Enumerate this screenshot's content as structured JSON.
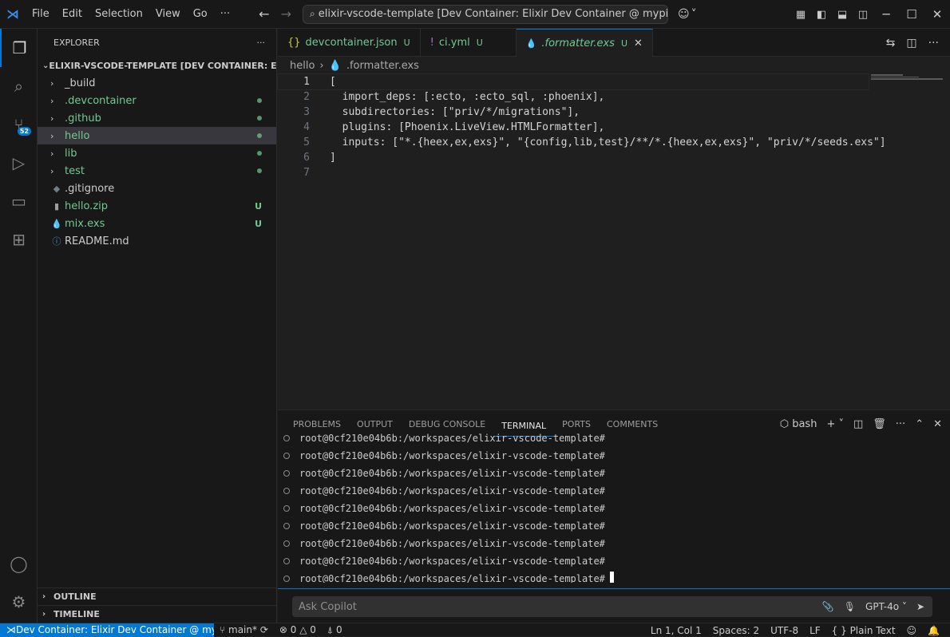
{
  "titlebar": {
    "menu": [
      "File",
      "Edit",
      "Selection",
      "View",
      "Go",
      "···"
    ],
    "nav_back": "←",
    "nav_forward": "→",
    "command_center": "elixir-vscode-template [Dev Container: Elixir Dev Container @ mypi4.local]",
    "copilot_chevron": "˅"
  },
  "activity": {
    "scm_badge": "52"
  },
  "sidebar": {
    "title": "EXPLORER",
    "more": "···",
    "root": "ELIXIR-VSCODE-TEMPLATE [DEV CONTAINER: ELIXI...",
    "items": [
      {
        "label": "_build",
        "type": "folder"
      },
      {
        "label": ".devcontainer",
        "type": "folder"
      },
      {
        "label": ".github",
        "type": "folder"
      },
      {
        "label": "hello",
        "type": "folder"
      },
      {
        "label": "lib",
        "type": "folder"
      },
      {
        "label": "test",
        "type": "folder"
      },
      {
        "label": ".gitignore",
        "type": "file"
      },
      {
        "label": "hello.zip",
        "type": "file",
        "status": "U"
      },
      {
        "label": "mix.exs",
        "type": "file",
        "status": "U"
      },
      {
        "label": "README.md",
        "type": "file"
      }
    ],
    "outline": "OUTLINE",
    "timeline": "TIMELINE"
  },
  "tabs": [
    {
      "label": "devcontainer.json",
      "status": "U",
      "icon": "{}"
    },
    {
      "label": "ci.yml",
      "status": "U",
      "icon": "!"
    },
    {
      "label": ".formatter.exs",
      "status": "U",
      "icon": "💧"
    }
  ],
  "breadcrumb": {
    "folder": "hello",
    "file": ".formatter.exs"
  },
  "editor": {
    "lines": [
      "[",
      "  import_deps: [:ecto, :ecto_sql, :phoenix],",
      "  subdirectories: [\"priv/*/migrations\"],",
      "  plugins: [Phoenix.LiveView.HTMLFormatter],",
      "  inputs: [\"*.{heex,ex,exs}\", \"{config,lib,test}/**/*.{heex,ex,exs}\", \"priv/*/seeds.exs\"]",
      "]",
      ""
    ]
  },
  "panel": {
    "tabs": [
      "PROBLEMS",
      "OUTPUT",
      "DEBUG CONSOLE",
      "TERMINAL",
      "PORTS",
      "COMMENTS"
    ],
    "shell": "bash",
    "terminal_prompt": "root@0cf210e04b6b:/workspaces/elixir-vscode-template#",
    "terminal_line_count": 9
  },
  "chat": {
    "placeholder": "Ask Copilot",
    "model": "GPT-4o"
  },
  "status": {
    "remote": "Dev Container: Elixir Dev Container @ my...",
    "branch": "main*",
    "errors": "0",
    "warnings": "0",
    "ports": "0",
    "position": "Ln 1, Col 1",
    "spaces": "Spaces: 2",
    "encoding": "UTF-8",
    "eol": "LF",
    "language": "{ } Plain Text"
  },
  "colors": {
    "accent": "#0078d4",
    "untracked": "#73c991",
    "background": "#1f1f1f"
  }
}
